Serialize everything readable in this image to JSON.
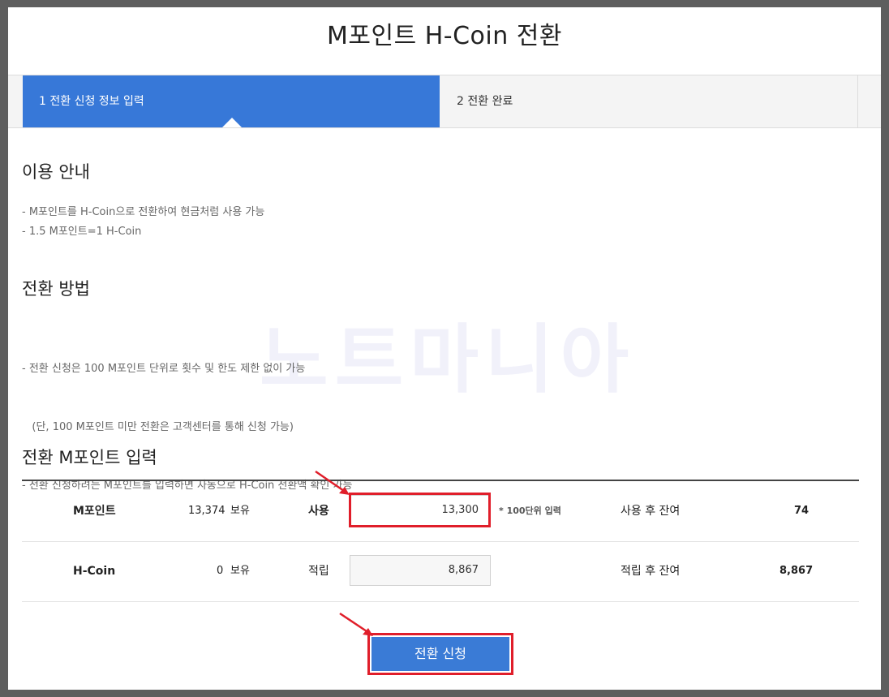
{
  "page": {
    "title": "M포인트 H-Coin 전환"
  },
  "steps": [
    {
      "label": "1 전환 신청 정보 입력",
      "active": true
    },
    {
      "label": "2 전환 완료",
      "active": false
    }
  ],
  "watermark": "노트마니아",
  "usage_guide": {
    "heading": "이용 안내",
    "lines": [
      "- M포인트를 H-Coin으로 전환하여 현금처럼 사용 가능",
      "- 1.5 M포인트=1 H-Coin"
    ]
  },
  "conversion_method": {
    "heading": "전환 방법",
    "lines": [
      "- 전환 신청은 100 M포인트 단위로 횟수 및 한도 제한 없이 가능",
      "   (단, 100 M포인트 미만 전환은 고객센터를 통해 신청 가능)",
      "- 전환 신청하려는 M포인트를 입력하면 자동으로 H-Coin 전환액 확인 가능"
    ]
  },
  "input_section": {
    "heading": "전환 M포인트 입력",
    "rows": [
      {
        "name": "M포인트",
        "held_amount": "13,374",
        "held_label": "보유",
        "action_label": "사용",
        "input_value": "13,300",
        "note": "* 100단위 입력",
        "remain_label": "사용 후 잔여",
        "remain_value": "74"
      },
      {
        "name": "H-Coin",
        "held_amount": "0",
        "held_label": "보유",
        "action_label": "적립",
        "input_value": "8,867",
        "remain_label": "적립 후 잔여",
        "remain_value": "8,867"
      }
    ]
  },
  "submit": {
    "label": "전환 신청"
  },
  "colors": {
    "accent": "#3778d8",
    "highlight": "#e01e2a",
    "outer_frame": "#5e5e5e"
  }
}
